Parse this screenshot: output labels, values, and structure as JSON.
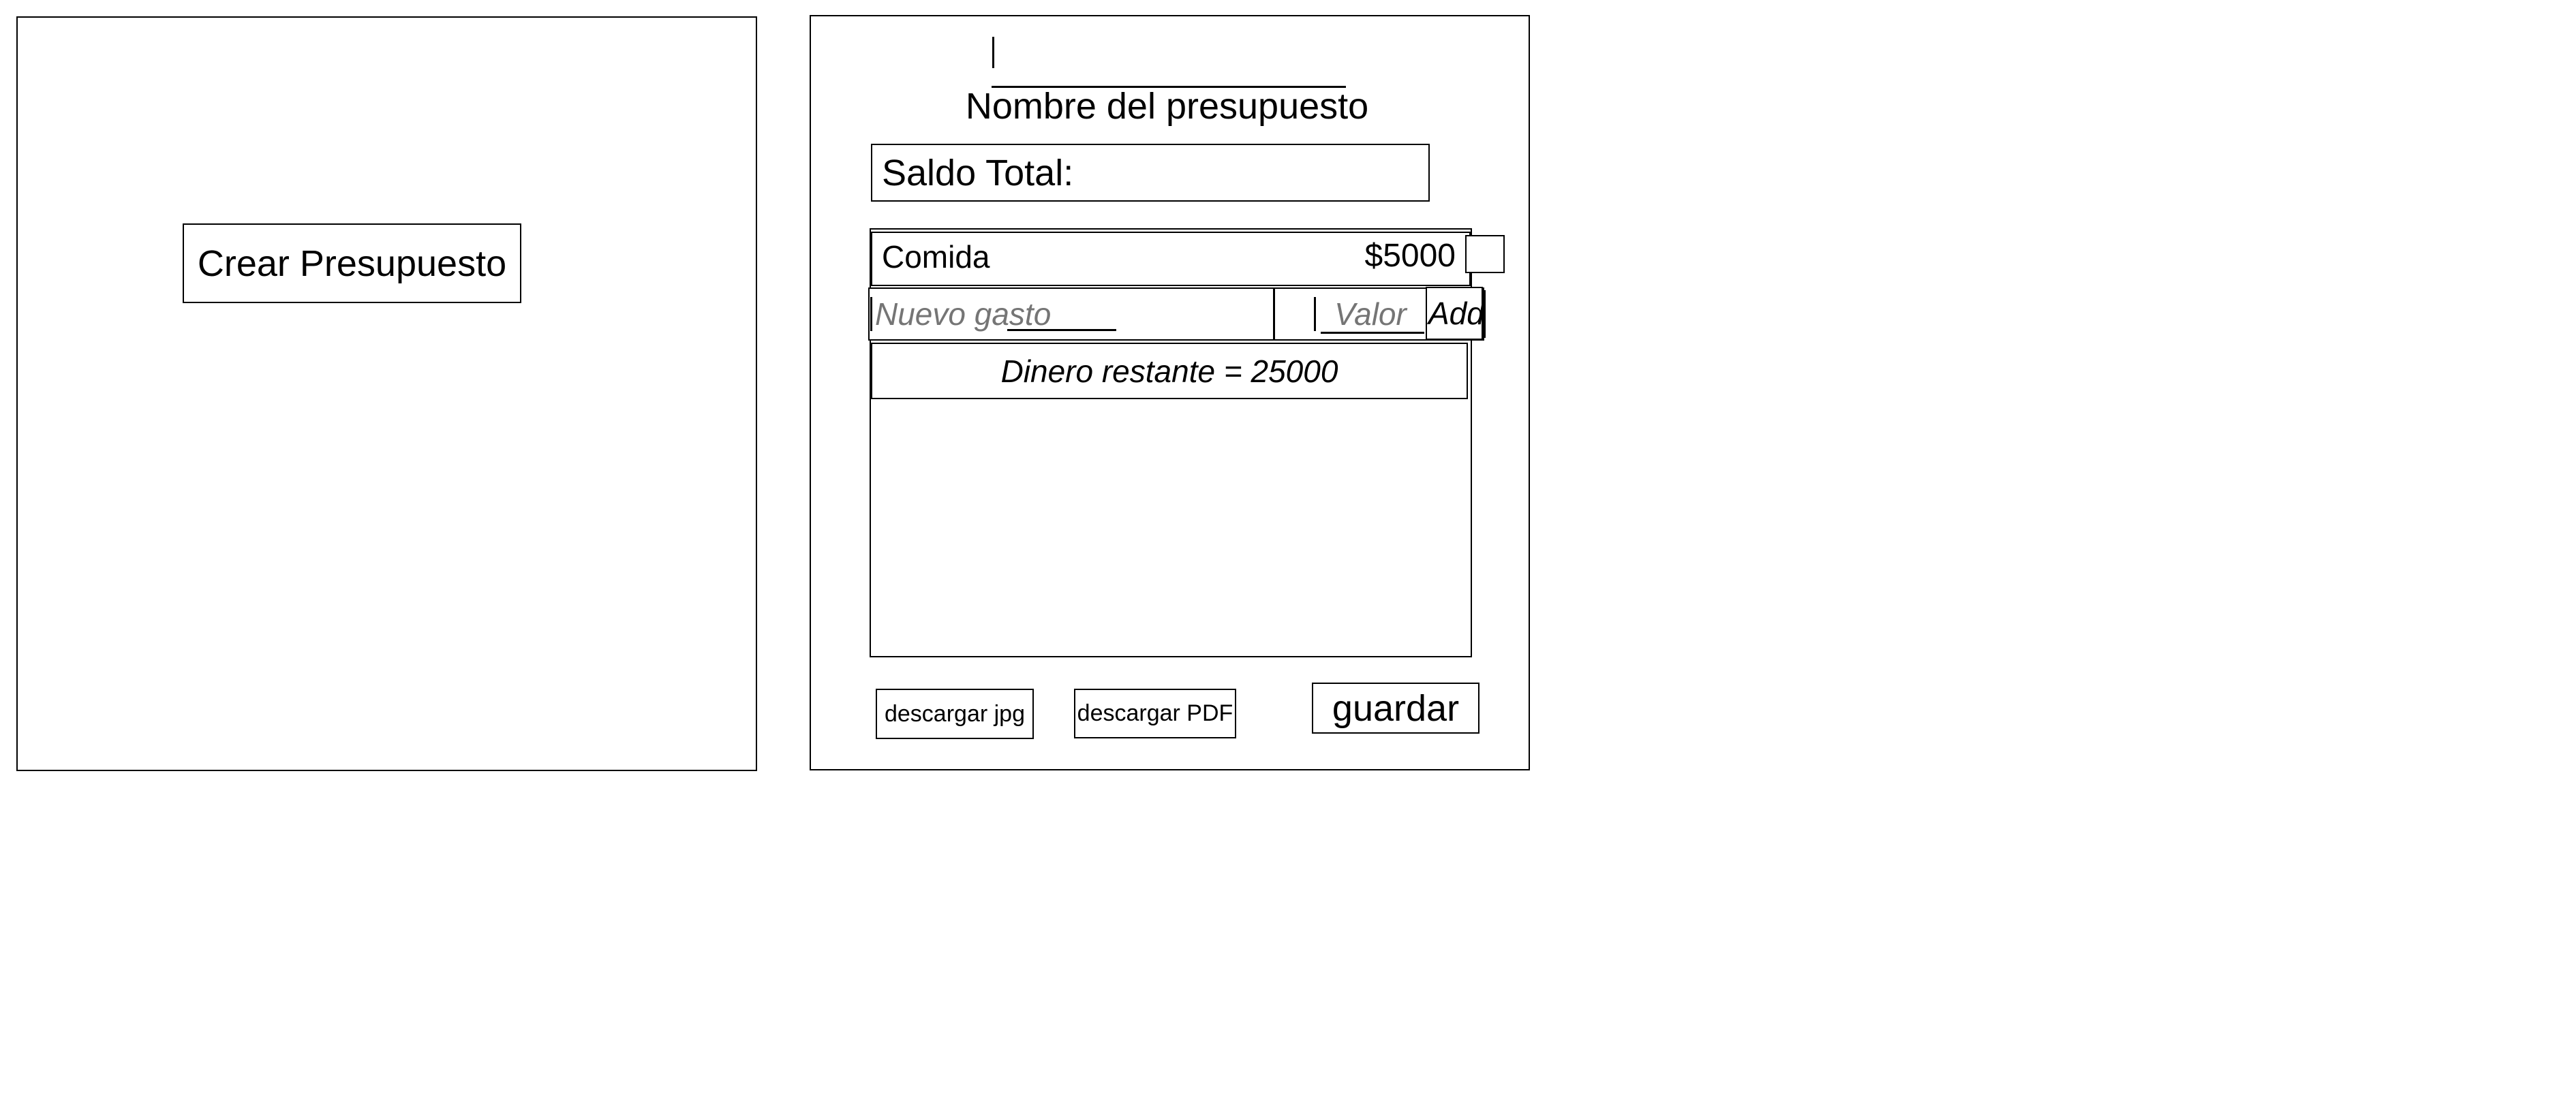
{
  "left_panel": {
    "create_button_label": "Crear Presupuesto"
  },
  "right_panel": {
    "budget_name": {
      "value": "",
      "caption": "Nombre del presupuesto"
    },
    "saldo_total_label": "Saldo Total:",
    "expenses": [
      {
        "name": "Comida",
        "amount": "$5000"
      }
    ],
    "new_expense": {
      "name_placeholder": "Nuevo gasto",
      "value_placeholder": "Valor",
      "add_label": "Add"
    },
    "remaining_text": "Dinero restante = 25000",
    "buttons": {
      "download_jpg": "descargar jpg",
      "download_pdf": "descargar PDF",
      "save": "guardar"
    }
  }
}
